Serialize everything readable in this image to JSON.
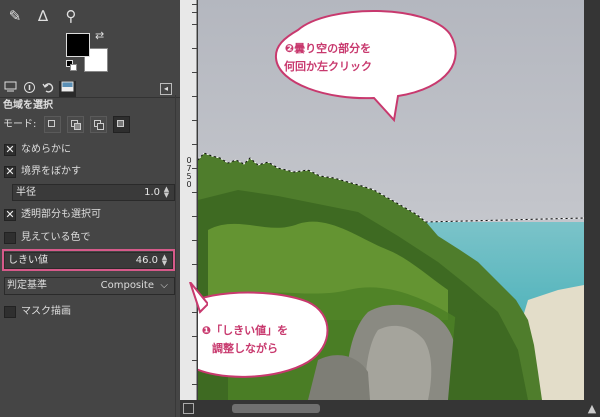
{
  "toolbox": {
    "tools": [
      {
        "icon": "color-picker-icon",
        "glyph": "✎"
      },
      {
        "icon": "measure-icon",
        "glyph": "∆"
      },
      {
        "icon": "zoom-icon",
        "glyph": "⚲"
      }
    ],
    "swap_glyph": "⇄"
  },
  "tabs": {
    "menu_glyph": "◂"
  },
  "tool_options": {
    "title": "色域を選択",
    "mode_label": "モード:",
    "antialias": {
      "label": "なめらかに",
      "checked": true
    },
    "feather": {
      "label": "境界をぼかす",
      "checked": true
    },
    "radius": {
      "label": "半径",
      "value": "1.0"
    },
    "select_transparent": {
      "label": "透明部分も選択可",
      "checked": true
    },
    "sample_merged": {
      "label": "見えている色で",
      "checked": false
    },
    "threshold": {
      "label": "しきい値",
      "value": "46.0"
    },
    "criterion": {
      "label": "判定基準",
      "value": "Composite"
    },
    "draw_mask": {
      "label": "マスク描画",
      "checked": false
    }
  },
  "ruler": {
    "numbers": [
      "0",
      "7",
      "5",
      "0"
    ]
  },
  "callouts": {
    "top": {
      "line1": "❷曇り空の部分を",
      "line2": "何回か左クリック",
      "color": "#c8396e"
    },
    "bottom": {
      "line1": "❶「しきい値」を",
      "line2": "調整しながら",
      "color": "#c8396e"
    }
  },
  "highlight_color": "#d65a8a"
}
